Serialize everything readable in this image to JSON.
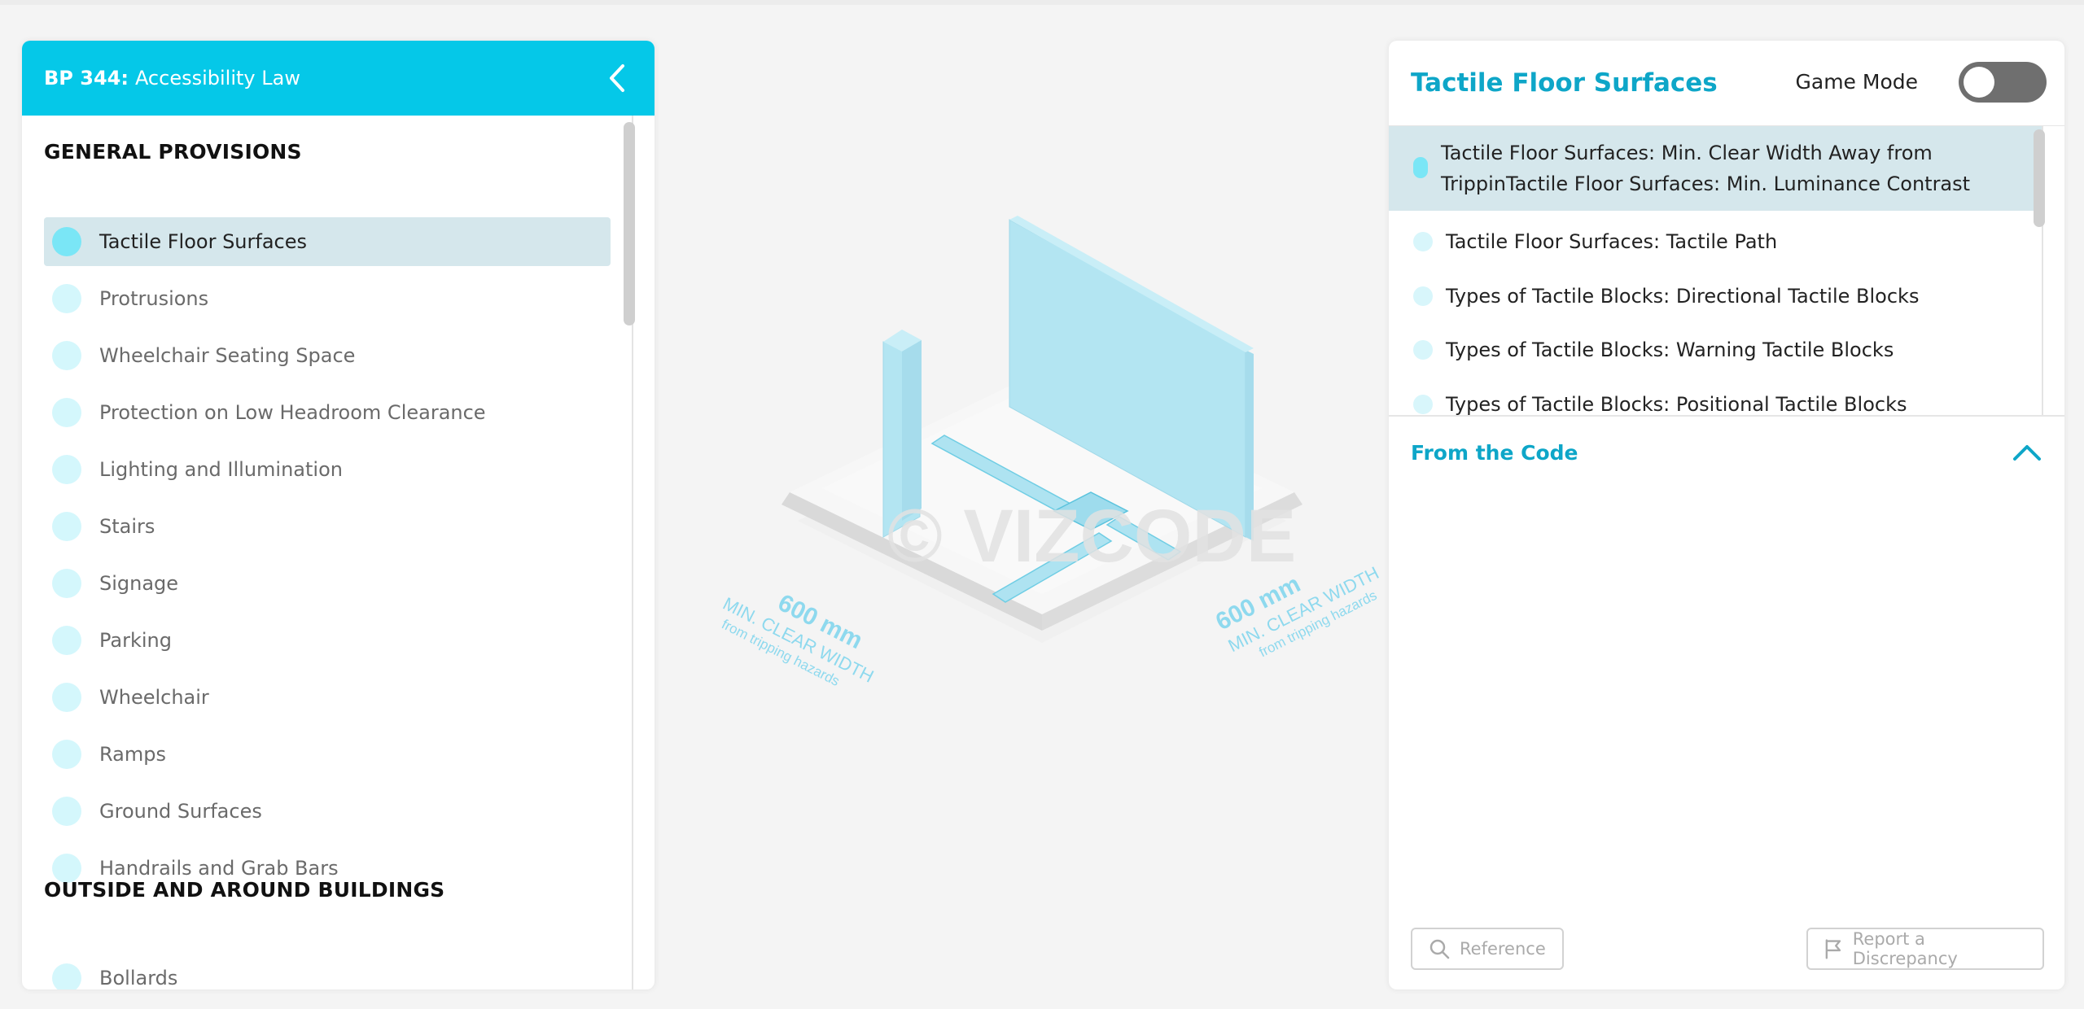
{
  "left_panel": {
    "code": "BP 344:",
    "title": "Accessibility Law",
    "sections": [
      {
        "heading": "GENERAL PROVISIONS",
        "items": [
          "Tactile Floor Surfaces",
          "Protrusions",
          "Wheelchair Seating Space",
          "Protection on Low Headroom Clearance",
          "Lighting and Illumination",
          "Stairs",
          "Signage",
          "Parking",
          "Wheelchair",
          "Ramps",
          "Ground Surfaces",
          "Handrails and Grab Bars"
        ]
      },
      {
        "heading": "OUTSIDE AND AROUND BUILDINGS",
        "items": [
          "Bollards"
        ]
      }
    ],
    "active_item": "Tactile Floor Surfaces"
  },
  "illustration": {
    "watermark": "© VIZCODE",
    "left_dimension": {
      "value": "600 mm",
      "label": "MIN. CLEAR WIDTH",
      "sub": "from tripping hazards"
    },
    "right_dimension": {
      "value": "600 mm",
      "label": "MIN. CLEAR WIDTH",
      "sub": "from tripping hazards"
    }
  },
  "right_panel": {
    "title": "Tactile Floor Surfaces",
    "game_mode_label": "Game Mode",
    "game_mode_on": false,
    "topics": [
      "Tactile Floor Surfaces: Min. Clear Width Away from TrippinTactile Floor Surfaces: Min. Luminance Contrast",
      "Tactile Floor Surfaces: Tactile Path",
      "Types of Tactile Blocks: Directional Tactile Blocks",
      "Types of Tactile Blocks: Warning Tactile Blocks",
      "Types of Tactile Blocks: Positional Tactile Blocks"
    ],
    "from_code_heading": "From the Code",
    "reference_label": "Reference",
    "report_label": "Report a Discrepancy"
  },
  "colors": {
    "brand": "#05c8e8",
    "accent_text": "#0ea6c8",
    "active_row": "#d5e7ec",
    "dot": "#d4f7fc",
    "illustration_blue": "#b3e5f2"
  },
  "icons": {
    "collapse": "chevron-left-icon",
    "code_toggle": "chevron-up-icon",
    "reference": "search-icon",
    "report": "flag-icon"
  }
}
